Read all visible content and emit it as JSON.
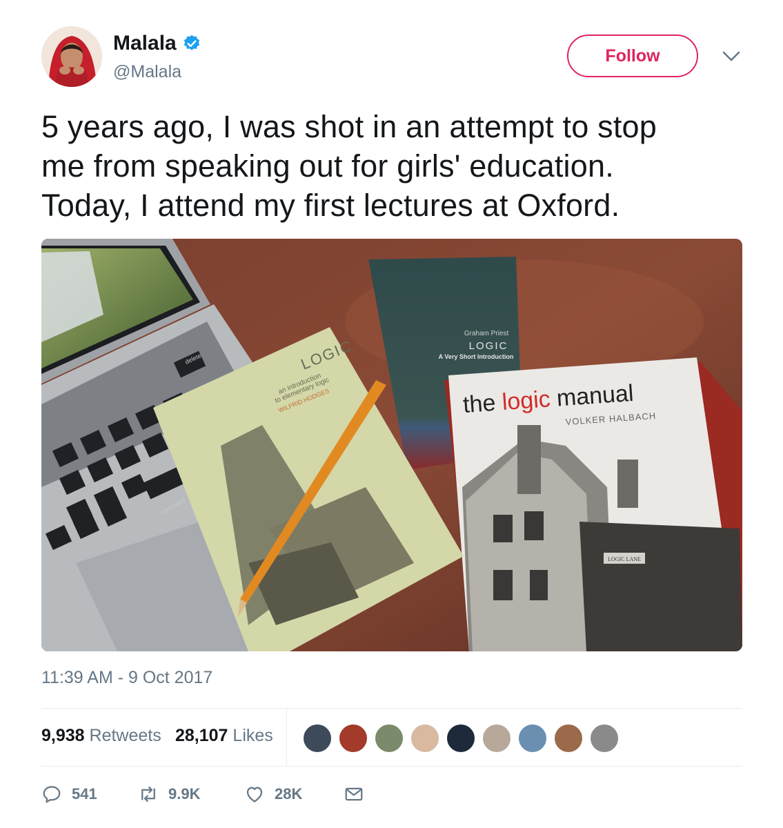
{
  "author": {
    "display_name": "Malala",
    "handle": "@Malala",
    "verified": true
  },
  "follow_label": "Follow",
  "tweet": {
    "lines": [
      "5 years ago, I was shot in an attempt to stop",
      "me from speaking out for girls' education.",
      "Today, I attend my first lectures at Oxford."
    ]
  },
  "photo": {
    "book1_title": "LOGIC",
    "book1_sub1": "an introduction",
    "book1_sub2": "to elementary logic",
    "book1_author": "WILFRID HODGES",
    "book2_author": "Graham Priest",
    "book2_title": "LOGIC",
    "book2_sub": "A Very Short Introduction",
    "book3_title_a": "the",
    "book3_title_b": "logic",
    "book3_title_c": "manual",
    "book3_author": "VOLKER HALBACH",
    "sign": "LOGIC LANE",
    "keys": [
      "delete",
      "command"
    ]
  },
  "timestamp": "11:39 AM - 9 Oct 2017",
  "stats": {
    "retweets_count": "9,938",
    "retweets_label": "Retweets",
    "likes_count": "28,107",
    "likes_label": "Likes"
  },
  "actions": {
    "reply_count": "541",
    "retweet_count": "9.9K",
    "like_count": "28K"
  },
  "colors": {
    "follow": "#e0245e",
    "verified": "#1da1f2",
    "secondary_text": "#657786"
  },
  "icons": [
    "verified-badge-icon",
    "chevron-down-icon",
    "reply-icon",
    "retweet-icon",
    "heart-icon",
    "envelope-icon"
  ]
}
